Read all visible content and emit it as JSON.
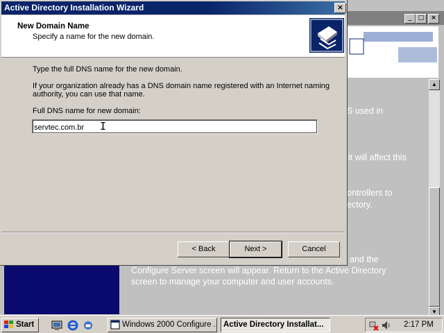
{
  "wizard": {
    "title": "Active Directory Installation Wizard",
    "header_title": "New Domain Name",
    "header_subtitle": "Specify a name for the new domain.",
    "instruction": "Type the full DNS name for the new domain.",
    "info_line1": "If your organization already has a DNS domain name registered with an Internet naming",
    "info_line2": "authority, you can use that name.",
    "field_label": "Full DNS name for new domain:",
    "field_value": "servtec.com.br",
    "back_label": "< Back",
    "next_label": "Next >",
    "cancel_label": "Cancel",
    "close_glyph": "×"
  },
  "background_window": {
    "fragments": [
      "S used in",
      "it will affect this",
      "ontrollers to",
      "ectory.",
      "and the"
    ],
    "line_configure": "Configure Server screen will appear. Return to the Active Directory",
    "line_screen": "screen to manage your computer and user accounts."
  },
  "taskbar": {
    "start_label": "Start",
    "task1_label": "Windows 2000 Configure ...",
    "task2_label": "Active Directory Installat...",
    "clock": "2:17 PM"
  },
  "colors": {
    "title_active": "#0a246a",
    "desktop": "#3a6ea5",
    "face": "#d4d0c8"
  }
}
